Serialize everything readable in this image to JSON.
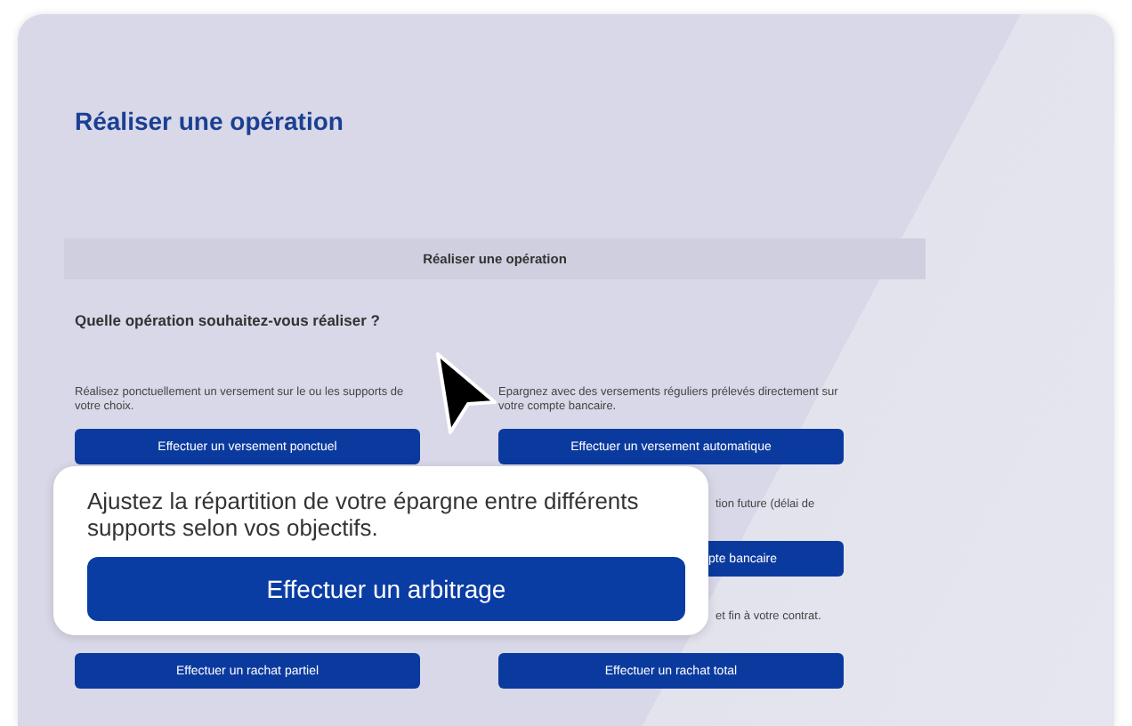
{
  "page_title": "Réaliser une opération",
  "panel": {
    "header": "Réaliser une opération",
    "question": "Quelle opération souhaitez-vous réaliser ?",
    "operations": [
      {
        "kind": "full",
        "description": "Réalisez ponctuellement un versement sur le ou les supports de votre choix.",
        "button": "Effectuer un versement ponctuel"
      },
      {
        "kind": "full",
        "description": "Epargnez avec des versements réguliers prélevés directement sur votre compte bancaire.",
        "button": "Effectuer un versement automatique"
      },
      {
        "kind": "covered"
      },
      {
        "kind": "partial",
        "description": "tion future (délai de",
        "button": "pte bancaire"
      },
      {
        "kind": "full",
        "button": "Effectuer un rachat partiel"
      },
      {
        "kind": "tail",
        "description": "et fin à votre contrat.",
        "button": "Effectuer un rachat total"
      }
    ]
  },
  "callout": {
    "text": "Ajustez la répartition de votre épargne entre différents supports selon vos objectifs.",
    "button": "Effectuer un arbitrage"
  }
}
